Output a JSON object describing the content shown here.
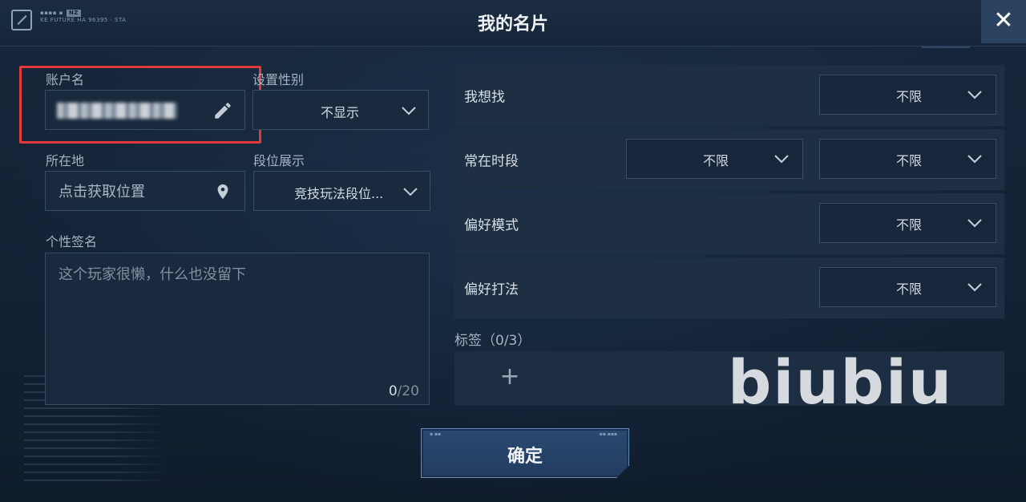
{
  "header": {
    "title": "我的名片",
    "brand_line": "KE FUTURE HA 96395 · STA",
    "brand_badge": "NZ",
    "close_label": "✕"
  },
  "profile": {
    "account": {
      "label": "账户名",
      "value": ""
    },
    "gender": {
      "label": "设置性别",
      "value": "不显示"
    },
    "location": {
      "label": "所在地",
      "placeholder": "点击获取位置"
    },
    "rank": {
      "label": "段位展示",
      "value": "竞技玩法段位..."
    },
    "signature": {
      "label": "个性签名",
      "placeholder": "这个玩家很懒，什么也没留下",
      "count_current": "0",
      "count_max": "/20"
    }
  },
  "preferences": {
    "looking_for": {
      "label": "我想找",
      "value": "不限"
    },
    "active_time": {
      "label": "常在时段",
      "start": "不限",
      "end": "不限"
    },
    "preferred_mode": {
      "label": "偏好模式",
      "value": "不限"
    },
    "preferred_style": {
      "label": "偏好打法",
      "value": "不限"
    }
  },
  "tags": {
    "label": "标签（0/3）",
    "add_label": "+"
  },
  "watermark": "biubiu",
  "confirm": {
    "label": "确定"
  },
  "colors": {
    "highlight": "#e2393b",
    "accent": "#2b4a72",
    "background": "#132033"
  },
  "icons": [
    "pencil-icon",
    "location-pin-icon",
    "chevron-down-icon",
    "close-icon",
    "app-logo-icon",
    "plus-icon"
  ]
}
